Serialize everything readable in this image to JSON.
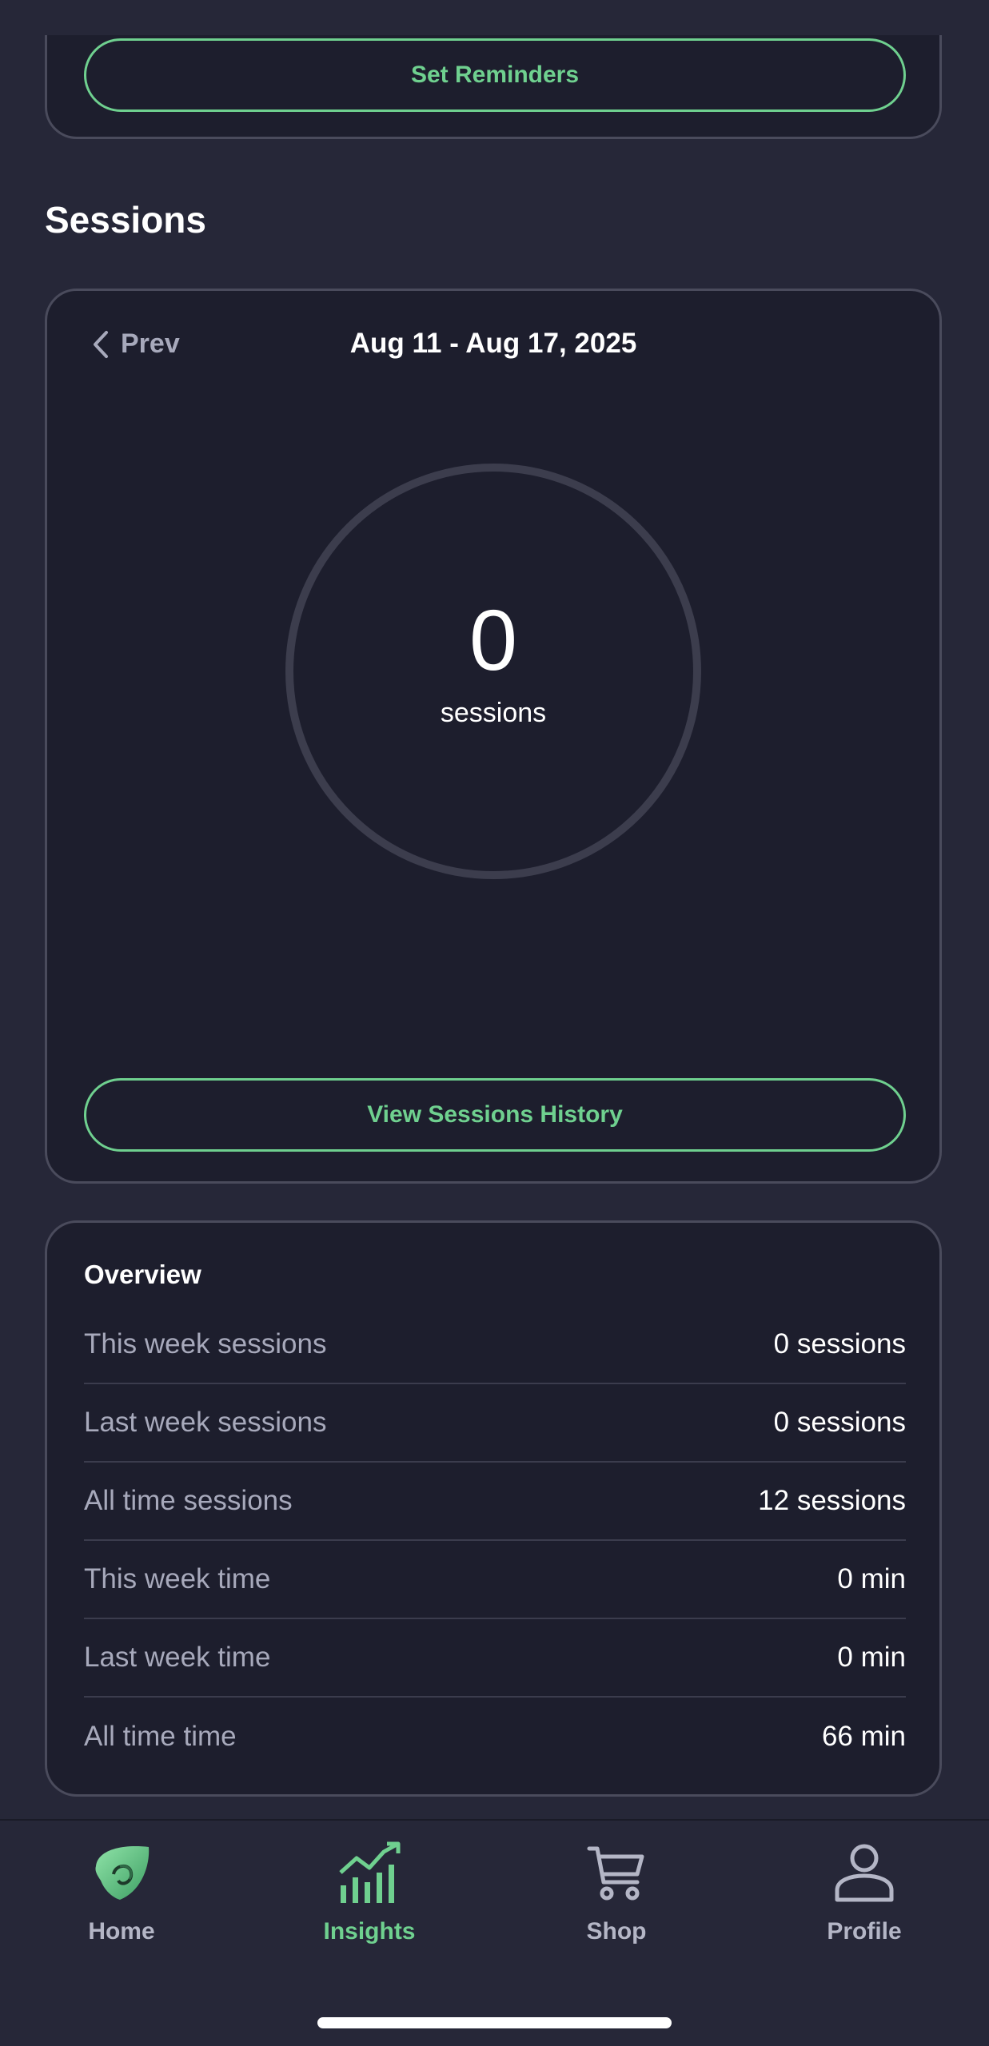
{
  "reminders": {
    "button_label": "Set Reminders"
  },
  "sessions": {
    "section_title": "Sessions",
    "prev_label": "Prev",
    "week_range": "Aug 11 - Aug 17, 2025",
    "count": "0",
    "count_unit": "sessions",
    "history_button_label": "View Sessions History"
  },
  "overview": {
    "title": "Overview",
    "rows": [
      {
        "label": "This week sessions",
        "value": "0 sessions"
      },
      {
        "label": "Last week sessions",
        "value": "0 sessions"
      },
      {
        "label": "All time sessions",
        "value": "12 sessions"
      },
      {
        "label": "This week time",
        "value": "0 min"
      },
      {
        "label": "Last week time",
        "value": "0 min"
      },
      {
        "label": "All time time",
        "value": "66 min"
      }
    ]
  },
  "tabbar": {
    "items": [
      {
        "label": "Home",
        "icon": "home-logo-icon"
      },
      {
        "label": "Insights",
        "icon": "chart-icon"
      },
      {
        "label": "Shop",
        "icon": "cart-icon"
      },
      {
        "label": "Profile",
        "icon": "person-icon"
      }
    ],
    "active": "Insights"
  },
  "colors": {
    "background": "#262738",
    "card": "#1d1e2d",
    "accent": "#6fd08f",
    "muted_text": "#a7a9bb",
    "ring": "#3c3d4d"
  }
}
